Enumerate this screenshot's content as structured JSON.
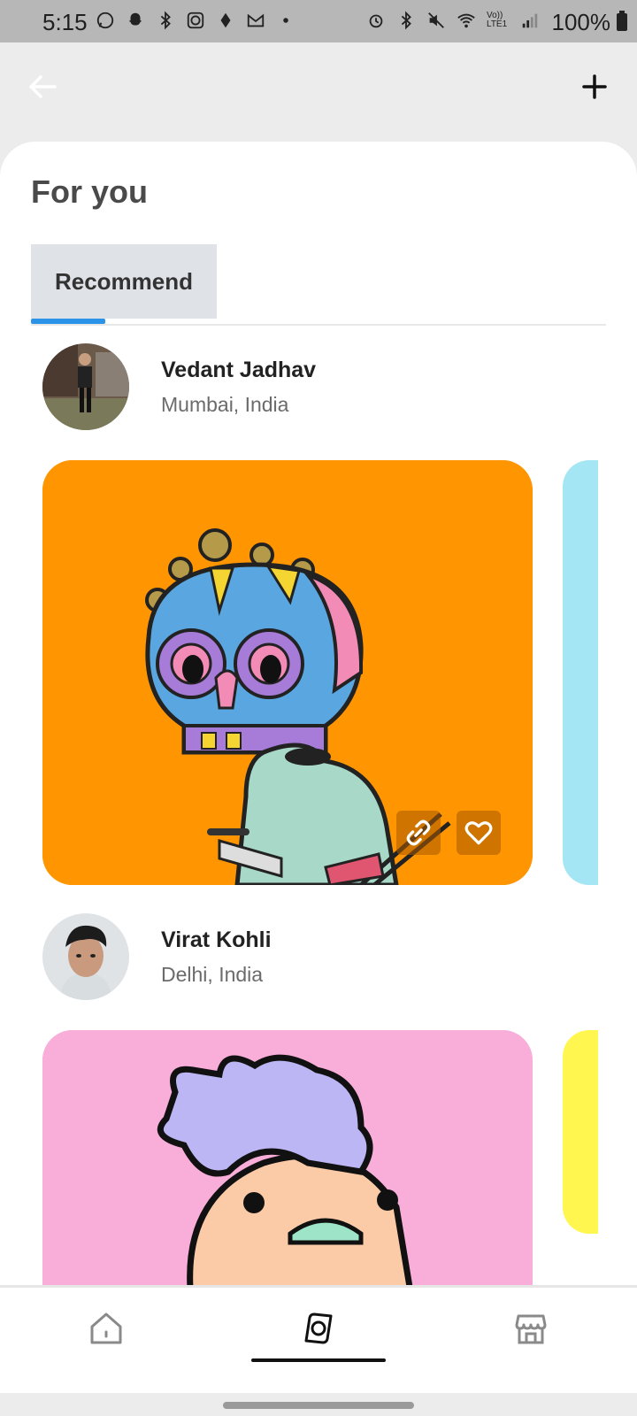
{
  "status_bar": {
    "time": "5:15",
    "battery": "100%",
    "left_icons": [
      "whatsapp-icon",
      "snapchat-icon",
      "bluetooth-icon",
      "cb-icon",
      "app-icon",
      "gmail-icon",
      "dot-icon"
    ],
    "right_icons": [
      "alarm-icon",
      "bluetooth-icon",
      "mute-icon",
      "wifi-icon",
      "volte-icon",
      "signal-icon",
      "battery-icon"
    ],
    "volte_text": "Vo)) LTE1"
  },
  "appbar": {
    "back_icon": "arrow-left-icon",
    "add_icon": "plus-icon"
  },
  "page": {
    "title": "For you",
    "tabs": [
      {
        "label": "Recommend",
        "active": true
      }
    ],
    "accent": "#2b93e8"
  },
  "feed": [
    {
      "user": {
        "name": "Vedant Jadhav",
        "location": "Mumbai, India"
      },
      "card_color": "#ff9500",
      "peek_color": "#a5e6f4"
    },
    {
      "user": {
        "name": "Virat Kohli",
        "location": "Delhi, India"
      },
      "card_color": "#f9aed9",
      "peek_color": "#fff64f"
    }
  ],
  "card_actions": [
    "link-icon",
    "heart-icon"
  ],
  "bottom_nav": {
    "items": [
      {
        "icon": "home-icon",
        "active": false
      },
      {
        "icon": "discover-icon",
        "active": true
      },
      {
        "icon": "store-icon",
        "active": false
      }
    ]
  }
}
